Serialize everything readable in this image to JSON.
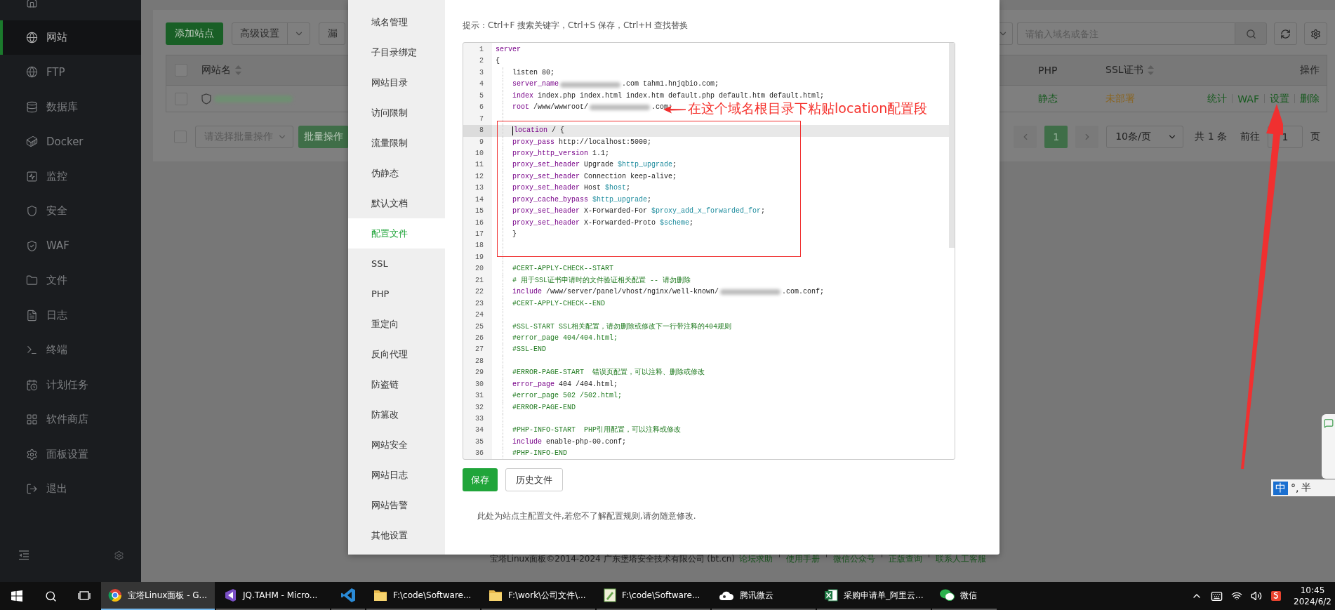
{
  "sidebar": {
    "items": [
      {
        "selected": false
      },
      {
        "label": "网站",
        "selected": true
      },
      {
        "label": "FTP",
        "selected": false
      },
      {
        "label": "数据库",
        "selected": false
      },
      {
        "label": "Docker",
        "selected": false
      },
      {
        "label": "监控",
        "selected": false
      },
      {
        "label": "安全",
        "selected": false
      },
      {
        "label": "WAF",
        "selected": false
      },
      {
        "label": "文件",
        "selected": false
      },
      {
        "label": "日志",
        "selected": false
      },
      {
        "label": "终端",
        "selected": false
      },
      {
        "label": "计划任务",
        "selected": false
      },
      {
        "label": "软件商店",
        "selected": false
      },
      {
        "label": "面板设置",
        "selected": false
      },
      {
        "label": "退出",
        "selected": false
      }
    ]
  },
  "page": {
    "toolbar": {
      "add_button": "添加站点",
      "advanced_button": "高级设置",
      "scan_button": "漏",
      "search": {
        "placeholder": "请输入域名或备注"
      }
    },
    "table": {
      "select_all": {
        "checked": false
      },
      "columns": [
        {
          "label": "网站名",
          "sortable": true
        },
        {
          "label": "PHP",
          "sortable": false
        },
        {
          "label": "SSL证书",
          "sortable": true
        },
        {
          "label": "操作",
          "sortable": false
        }
      ],
      "rows": [
        {
          "checked": false,
          "php": "静态",
          "ssl": "未部署",
          "actions": [
            "统计",
            "WAF",
            "设置",
            "删除"
          ]
        }
      ]
    },
    "batch": {
      "checked": false,
      "placeholder": "请选择批量操作",
      "button": "批量操作"
    },
    "pagination": {
      "pages": [
        {
          "label": "1",
          "selected": true
        }
      ],
      "page_size": "10条/页",
      "total": "共 1 条",
      "goto_label": "前往",
      "goto_value": "1",
      "goto_suffix": "页"
    }
  },
  "footer": {
    "copyright": "宝塔Linux面板©2014-2024 广东堡塔安全技术有限公司 (bt.cn)",
    "links": [
      "论坛求助",
      "使用手册",
      "微信公众号",
      "正版查询",
      "联系人工客服"
    ]
  },
  "modal": {
    "tabs": [
      {
        "label": "域名管理",
        "selected": false
      },
      {
        "label": "子目录绑定",
        "selected": false
      },
      {
        "label": "网站目录",
        "selected": false
      },
      {
        "label": "访问限制",
        "selected": false
      },
      {
        "label": "流量限制",
        "selected": false
      },
      {
        "label": "伪静态",
        "selected": false
      },
      {
        "label": "默认文档",
        "selected": false
      },
      {
        "label": "配置文件",
        "selected": true
      },
      {
        "label": "SSL",
        "selected": false
      },
      {
        "label": "PHP",
        "selected": false
      },
      {
        "label": "重定向",
        "selected": false
      },
      {
        "label": "反向代理",
        "selected": false
      },
      {
        "label": "防盗链",
        "selected": false
      },
      {
        "label": "防篡改",
        "selected": false
      },
      {
        "label": "网站安全",
        "selected": false
      },
      {
        "label": "网站日志",
        "selected": false
      },
      {
        "label": "网站告警",
        "selected": false
      },
      {
        "label": "其他设置",
        "selected": false
      }
    ],
    "hint": "提示：Ctrl+F 搜索关键字，Ctrl+S 保存，Ctrl+H 查找替换",
    "editor": {
      "lines": [
        {
          "n": "1",
          "current": false,
          "indented": false,
          "tokens": [
            {
              "kind": "kw",
              "s": "server"
            }
          ]
        },
        {
          "n": "2",
          "current": false,
          "indented": false,
          "tokens": [
            {
              "kind": "text",
              "s": "{"
            }
          ]
        },
        {
          "n": "3",
          "current": false,
          "indented": true,
          "tokens": [
            {
              "kind": "text",
              "s": "listen 80;"
            }
          ]
        },
        {
          "n": "4",
          "current": false,
          "indented": true,
          "tokens": [
            {
              "kind": "kw",
              "s": "server_name"
            },
            {
              "kind": "blur"
            },
            {
              "kind": "text",
              "s": ".com tahm1.hnjqbio.com;"
            }
          ]
        },
        {
          "n": "5",
          "current": false,
          "indented": true,
          "tokens": [
            {
              "kind": "kw",
              "s": "index"
            },
            {
              "kind": "text",
              "s": " index.php index.html index.htm default.php default.htm default.html;"
            }
          ]
        },
        {
          "n": "6",
          "current": false,
          "indented": true,
          "tokens": [
            {
              "kind": "kw",
              "s": "root"
            },
            {
              "kind": "text",
              "s": " /www/wwwroot/"
            },
            {
              "kind": "blur"
            },
            {
              "kind": "text",
              "s": ".com;"
            }
          ]
        },
        {
          "n": "7",
          "current": false,
          "indented": true
        },
        {
          "n": "8",
          "current": true,
          "indented": true,
          "tokens": [
            {
              "kind": "kw",
              "s": "location"
            },
            {
              "kind": "text",
              "s": " / {"
            }
          ]
        },
        {
          "n": "9",
          "current": false,
          "indented": true,
          "tokens": [
            {
              "kind": "kw",
              "s": "proxy_pass"
            },
            {
              "kind": "text",
              "s": " http://localhost:5000;"
            }
          ]
        },
        {
          "n": "10",
          "current": false,
          "indented": true,
          "tokens": [
            {
              "kind": "kw",
              "s": "proxy_http_version"
            },
            {
              "kind": "text",
              "s": " 1.1;"
            }
          ]
        },
        {
          "n": "11",
          "current": false,
          "indented": true,
          "tokens": [
            {
              "kind": "kw",
              "s": "proxy_set_header"
            },
            {
              "kind": "text",
              "s": " Upgrade "
            },
            {
              "kind": "var",
              "s": "$http_upgrade"
            },
            {
              "kind": "text",
              "s": ";"
            }
          ]
        },
        {
          "n": "12",
          "current": false,
          "indented": true,
          "tokens": [
            {
              "kind": "kw",
              "s": "proxy_set_header"
            },
            {
              "kind": "text",
              "s": " Connection keep-alive;"
            }
          ]
        },
        {
          "n": "13",
          "current": false,
          "indented": true,
          "tokens": [
            {
              "kind": "kw",
              "s": "proxy_set_header"
            },
            {
              "kind": "text",
              "s": " Host "
            },
            {
              "kind": "var",
              "s": "$host"
            },
            {
              "kind": "text",
              "s": ";"
            }
          ]
        },
        {
          "n": "14",
          "current": false,
          "indented": true,
          "tokens": [
            {
              "kind": "kw",
              "s": "proxy_cache_bypass"
            },
            {
              "kind": "var",
              "s": " $http_upgrade"
            },
            {
              "kind": "text",
              "s": ";"
            }
          ]
        },
        {
          "n": "15",
          "current": false,
          "indented": true,
          "tokens": [
            {
              "kind": "kw",
              "s": "proxy_set_header"
            },
            {
              "kind": "text",
              "s": " X-Forwarded-For "
            },
            {
              "kind": "var",
              "s": "$proxy_add_x_forwarded_for"
            },
            {
              "kind": "text",
              "s": ";"
            }
          ]
        },
        {
          "n": "16",
          "current": false,
          "indented": true,
          "tokens": [
            {
              "kind": "kw",
              "s": "proxy_set_header"
            },
            {
              "kind": "text",
              "s": " X-Forwarded-Proto "
            },
            {
              "kind": "var",
              "s": "$scheme"
            },
            {
              "kind": "text",
              "s": ";"
            }
          ]
        },
        {
          "n": "17",
          "current": false,
          "indented": true,
          "tokens": [
            {
              "kind": "text",
              "s": "}"
            }
          ]
        },
        {
          "n": "18",
          "current": false,
          "indented": true
        },
        {
          "n": "19",
          "current": false,
          "indented": true
        },
        {
          "n": "20",
          "current": false,
          "indented": true,
          "tokens": [
            {
              "kind": "comment",
              "s": "#CERT-APPLY-CHECK--START"
            }
          ]
        },
        {
          "n": "21",
          "current": false,
          "indented": true,
          "tokens": [
            {
              "kind": "comment",
              "s": "# 用于SSL证书申请时的文件验证相关配置 -- 请勿删除"
            }
          ]
        },
        {
          "n": "22",
          "current": false,
          "indented": true,
          "tokens": [
            {
              "kind": "kw",
              "s": "include"
            },
            {
              "kind": "text",
              "s": " /www/server/panel/vhost/nginx/well-known/"
            },
            {
              "kind": "blur"
            },
            {
              "kind": "text",
              "s": ".com.conf;"
            }
          ]
        },
        {
          "n": "23",
          "current": false,
          "indented": true,
          "tokens": [
            {
              "kind": "comment",
              "s": "#CERT-APPLY-CHECK--END"
            }
          ]
        },
        {
          "n": "24",
          "current": false,
          "indented": true
        },
        {
          "n": "25",
          "current": false,
          "indented": true,
          "tokens": [
            {
              "kind": "comment",
              "s": "#SSL-START SSL相关配置，请勿删除或修改下一行带注释的404规则"
            }
          ]
        },
        {
          "n": "26",
          "current": false,
          "indented": true,
          "tokens": [
            {
              "kind": "comment",
              "s": "#error_page 404/404.html;"
            }
          ]
        },
        {
          "n": "27",
          "current": false,
          "indented": true,
          "tokens": [
            {
              "kind": "comment",
              "s": "#SSL-END"
            }
          ]
        },
        {
          "n": "28",
          "current": false,
          "indented": true
        },
        {
          "n": "29",
          "current": false,
          "indented": true,
          "tokens": [
            {
              "kind": "comment",
              "s": "#ERROR-PAGE-START  错误页配置，可以注释、删除或修改"
            }
          ]
        },
        {
          "n": "30",
          "current": false,
          "indented": true,
          "tokens": [
            {
              "kind": "kw",
              "s": "error_page"
            },
            {
              "kind": "text",
              "s": " 404 /404.html;"
            }
          ]
        },
        {
          "n": "31",
          "current": false,
          "indented": true,
          "tokens": [
            {
              "kind": "comment",
              "s": "#error_page 502 /502.html;"
            }
          ]
        },
        {
          "n": "32",
          "current": false,
          "indented": true,
          "tokens": [
            {
              "kind": "comment",
              "s": "#ERROR-PAGE-END"
            }
          ]
        },
        {
          "n": "33",
          "current": false,
          "indented": true
        },
        {
          "n": "34",
          "current": false,
          "indented": true,
          "tokens": [
            {
              "kind": "comment",
              "s": "#PHP-INFO-START  PHP引用配置，可以注释或修改"
            }
          ]
        },
        {
          "n": "35",
          "current": false,
          "indented": true,
          "tokens": [
            {
              "kind": "kw",
              "s": "include"
            },
            {
              "kind": "text",
              "s": " enable-php-00.conf;"
            }
          ]
        },
        {
          "n": "36",
          "current": false,
          "indented": true,
          "tokens": [
            {
              "kind": "comment",
              "s": "#PHP-INFO-END"
            }
          ]
        }
      ]
    },
    "save_button": "保存",
    "history_button": "历史文件",
    "note": "此处为站点主配置文件,若您不了解配置规则,请勿随意修改."
  },
  "annotation": {
    "note": "在这个域名根目录下粘贴location配置段"
  },
  "ime_bar": {
    "mode": "中",
    "punct": "°,",
    "width": "半"
  },
  "taskbar": {
    "apps": [
      {
        "label": "宝塔Linux面板 - G...",
        "selected": true
      },
      {
        "label": "JQ.TAHM - Micro...",
        "selected": false
      },
      {
        "selected": false
      },
      {
        "label": "F:\\code\\Software...",
        "selected": false
      },
      {
        "label": "F:\\work\\公司文件\\...",
        "selected": false
      },
      {
        "label": "F:\\code\\Software...",
        "selected": false
      },
      {
        "label": "腾讯微云",
        "selected": false
      },
      {
        "label": "采购申请单_阿里云...",
        "selected": false
      },
      {
        "label": "微信",
        "selected": false
      }
    ],
    "time": "10:45",
    "date": "2024/6/2"
  }
}
